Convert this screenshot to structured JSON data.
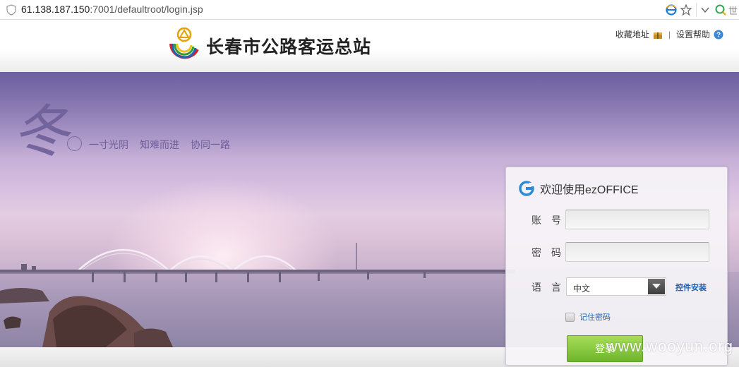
{
  "browser": {
    "url_host": "61.138.187.150",
    "url_rest": ":7001/defaultroot/login.jsp",
    "world_glyph": "世",
    "icons": [
      "shield-icon",
      "ie-icon",
      "star-icon",
      "dropdown-icon",
      "search-icon"
    ]
  },
  "header": {
    "site_title": "长春市公路客运总站",
    "links": {
      "favorite": "收藏地址",
      "divider": "|",
      "settings_help": "设置帮助"
    }
  },
  "hero": {
    "season_char": "冬",
    "slogans": [
      "一寸光阴",
      "知难而进",
      "协同一路"
    ]
  },
  "login": {
    "title": "欢迎使用ezOFFICE",
    "account_label": "账　号",
    "account_value": "",
    "password_label": "密　码",
    "password_value": "",
    "language_label": "语　言",
    "language_value": "中文",
    "install_link": "控件安装",
    "remember_label": "记住密码",
    "remember_checked": false,
    "login_button": "登录"
  },
  "colors": {
    "link": "#1f5fb0",
    "login_green": "#6fb52c",
    "slogan": "#6e5f9c"
  },
  "watermark": "www.wooyun.org"
}
